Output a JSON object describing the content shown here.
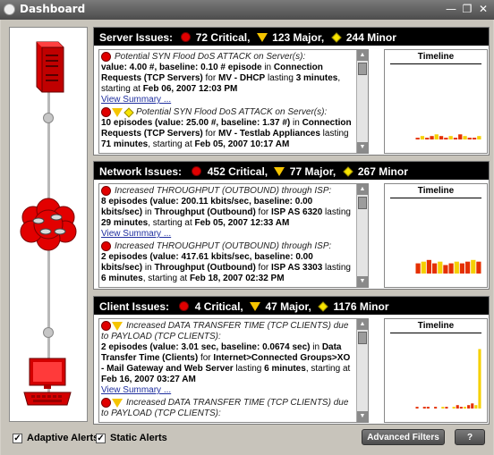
{
  "window": {
    "title": "Dashboard",
    "controls": [
      "—",
      "❐",
      "✕"
    ]
  },
  "colors": {
    "critical": "#e00000",
    "major": "#f5c400",
    "minor": "#f7e400",
    "bar": "#e53000",
    "bar_alt": "#f5d000"
  },
  "panels": [
    {
      "id": "server",
      "header": {
        "label": "Server Issues:",
        "critical": "72 Critical,",
        "major": "123 Major,",
        "minor": "244 Minor"
      },
      "timeline_title": "Timeline",
      "timeline_values": [
        1,
        2,
        1,
        2,
        3,
        2,
        1,
        2,
        1,
        3,
        2,
        1,
        1,
        2
      ],
      "entries": [
        {
          "icons": [
            "critical"
          ],
          "heading": "Potential SYN Flood DoS ATTACK on Server(s):",
          "body_parts": [
            {
              "b": true,
              "t": "value: 4.00 #, baseline: 0.10 # episode"
            },
            {
              "b": false,
              "t": " in "
            },
            {
              "b": true,
              "t": "Connection Requests (TCP Servers)"
            },
            {
              "b": false,
              "t": " for "
            },
            {
              "b": true,
              "t": "MV - DHCP"
            },
            {
              "b": false,
              "t": " lasting "
            },
            {
              "b": true,
              "t": "3 minutes"
            },
            {
              "b": false,
              "t": ", starting at "
            },
            {
              "b": true,
              "t": "Feb 06, 2007 12:03 PM"
            }
          ],
          "link": "View Summary ..."
        },
        {
          "icons": [
            "critical",
            "major",
            "minor"
          ],
          "heading": "Potential SYN Flood DoS ATTACK on Server(s):",
          "body_parts": [
            {
              "b": true,
              "t": "10 episodes (value: 25.00 #, baseline: 1.37 #)"
            },
            {
              "b": false,
              "t": " in "
            },
            {
              "b": true,
              "t": "Connection Requests (TCP Servers)"
            },
            {
              "b": false,
              "t": " for "
            },
            {
              "b": true,
              "t": "MV - Testlab Appliances"
            },
            {
              "b": false,
              "t": " lasting "
            },
            {
              "b": true,
              "t": "71 minutes"
            },
            {
              "b": false,
              "t": ", starting at "
            },
            {
              "b": true,
              "t": "Feb 05, 2007 10:17 AM"
            }
          ],
          "link": ""
        }
      ]
    },
    {
      "id": "network",
      "header": {
        "label": "Network Issues:",
        "critical": "452 Critical,",
        "major": "77 Major,",
        "minor": "267 Minor"
      },
      "timeline_title": "Timeline",
      "timeline_values": [
        6,
        7,
        8,
        6,
        7,
        5,
        6,
        7,
        6,
        7,
        8,
        7
      ],
      "entries": [
        {
          "icons": [
            "critical"
          ],
          "heading": "Increased THROUGHPUT (OUTBOUND) through ISP:",
          "body_parts": [
            {
              "b": true,
              "t": "8 episodes (value: 200.11 kbits/sec, baseline: 0.00 kbits/sec)"
            },
            {
              "b": false,
              "t": " in "
            },
            {
              "b": true,
              "t": "Throughput (Outbound)"
            },
            {
              "b": false,
              "t": " for "
            },
            {
              "b": true,
              "t": "ISP AS 6320"
            },
            {
              "b": false,
              "t": " lasting "
            },
            {
              "b": true,
              "t": "29 minutes"
            },
            {
              "b": false,
              "t": ", starting at "
            },
            {
              "b": true,
              "t": "Feb 05, 2007 12:33 AM"
            }
          ],
          "link": "View Summary ..."
        },
        {
          "icons": [
            "critical"
          ],
          "heading": "Increased THROUGHPUT (OUTBOUND) through ISP:",
          "body_parts": [
            {
              "b": true,
              "t": "2 episodes (value: 417.61 kbits/sec, baseline: 0.00 kbits/sec)"
            },
            {
              "b": false,
              "t": " in "
            },
            {
              "b": true,
              "t": "Throughput (Outbound)"
            },
            {
              "b": false,
              "t": " for "
            },
            {
              "b": true,
              "t": "ISP AS 3303"
            },
            {
              "b": false,
              "t": " lasting "
            },
            {
              "b": true,
              "t": "6 minutes"
            },
            {
              "b": false,
              "t": ", starting at "
            },
            {
              "b": true,
              "t": "Feb 18, 2007 02:32 PM"
            }
          ],
          "link": ""
        }
      ]
    },
    {
      "id": "client",
      "header": {
        "label": "Client Issues:",
        "critical": "4 Critical,",
        "major": "47 Major,",
        "minor": "1176 Minor"
      },
      "timeline_title": "Timeline",
      "timeline_values": [
        1,
        0,
        1,
        1,
        0,
        1,
        0,
        1,
        1,
        0,
        1,
        2,
        1,
        1,
        2,
        3,
        2,
        35
      ],
      "entries": [
        {
          "icons": [
            "critical",
            "major"
          ],
          "heading": "Increased DATA TRANSFER TIME (TCP CLIENTS) due to PAYLOAD (TCP CLIENTS):",
          "body_parts": [
            {
              "b": true,
              "t": "2 episodes (value: 3.01 sec, baseline: 0.0674 sec)"
            },
            {
              "b": false,
              "t": " in "
            },
            {
              "b": true,
              "t": "Data Transfer Time (Clients)"
            },
            {
              "b": false,
              "t": " for "
            },
            {
              "b": true,
              "t": "Internet>Connected Groups>XO - Mail Gateway and Web Server"
            },
            {
              "b": false,
              "t": " lasting "
            },
            {
              "b": true,
              "t": "6 minutes"
            },
            {
              "b": false,
              "t": ", starting at "
            },
            {
              "b": true,
              "t": "Feb 16, 2007 03:27 AM"
            }
          ],
          "link": "View Summary ..."
        },
        {
          "icons": [
            "critical",
            "major"
          ],
          "heading": "Increased DATA TRANSFER TIME (TCP CLIENTS) due to PAYLOAD (TCP CLIENTS):",
          "body_parts": [],
          "link": ""
        }
      ]
    }
  ],
  "footer": {
    "adaptive_alerts": "Adaptive Alerts",
    "static_alerts": "Static Alerts",
    "adaptive_checked": true,
    "static_checked": true,
    "advanced_filters": "Advanced Filters",
    "help": "?"
  }
}
